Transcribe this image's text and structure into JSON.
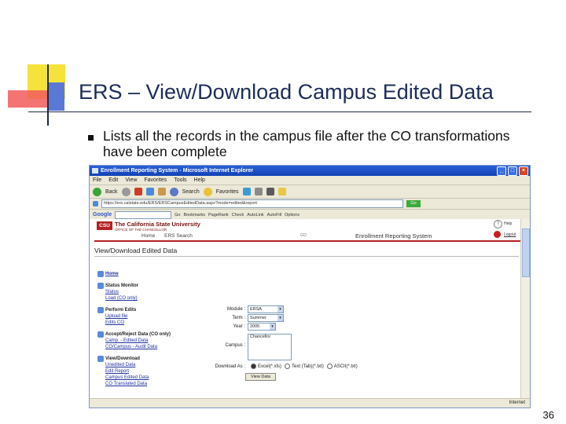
{
  "slide": {
    "title": "ERS – View/Download Campus Edited Data",
    "bullet": "Lists all the records in the campus file after the CO transformations have been complete",
    "page_number": "36"
  },
  "browser": {
    "window_title": "Enrollment Reporting System - Microsoft Internet Explorer",
    "menu": [
      "File",
      "Edit",
      "View",
      "Favorites",
      "Tools",
      "Help"
    ],
    "toolbar": {
      "back": "Back",
      "search": "Search",
      "favorites": "Favorites"
    },
    "address": "https://ers.calstate.edu/ERS/ERSCampusEditedData.aspx?mode=edited&report",
    "go_label": "Go",
    "google_label": "Google",
    "google_items": [
      "Go",
      "Bookmarks",
      "PageRank",
      "Check",
      "AutoLink",
      "AutoFill",
      "Options"
    ],
    "status_zone": "Internet"
  },
  "csu": {
    "logo": "CSU",
    "name": "The California State University",
    "subtitle": "OFFICE OF THE CHANCELLOR",
    "nav_home": "Home",
    "nav_search": "ERS Search",
    "go": "GO",
    "system_name": "Enrollment Reporting System",
    "help": "Help",
    "logout": "Logout"
  },
  "page": {
    "heading": "View/Download Edited Data"
  },
  "leftnav": {
    "home": "Home",
    "groups": [
      {
        "label": "Status Monitor",
        "links": [
          "Status",
          "Load (CO only)"
        ]
      },
      {
        "label": "Perform Edits",
        "links": [
          "Upload file",
          "Edits CO"
        ]
      },
      {
        "label": "Accept/Reject Data (CO only)",
        "links": [
          "Camp. - Edited Data",
          "CO/Campus - Audit Data"
        ]
      },
      {
        "label": "View/Download",
        "links": [
          "Unedited Data",
          "Edit Report",
          "Campus Edited Data",
          "CO Translated Data"
        ]
      }
    ]
  },
  "form": {
    "module_label": "Module :",
    "module_value": "ERSA",
    "term_label": "Term :",
    "term_value": "Summer",
    "year_label": "Year :",
    "year_value": "2005",
    "campus_label": "Campus :",
    "campus_value": "Chancellor",
    "download_label": "Download As :",
    "download_options": [
      "Excel(*.xls)",
      "Text (Tab)(*.txt)",
      "ASCII(*.txt)"
    ],
    "button_label": "View Data"
  }
}
